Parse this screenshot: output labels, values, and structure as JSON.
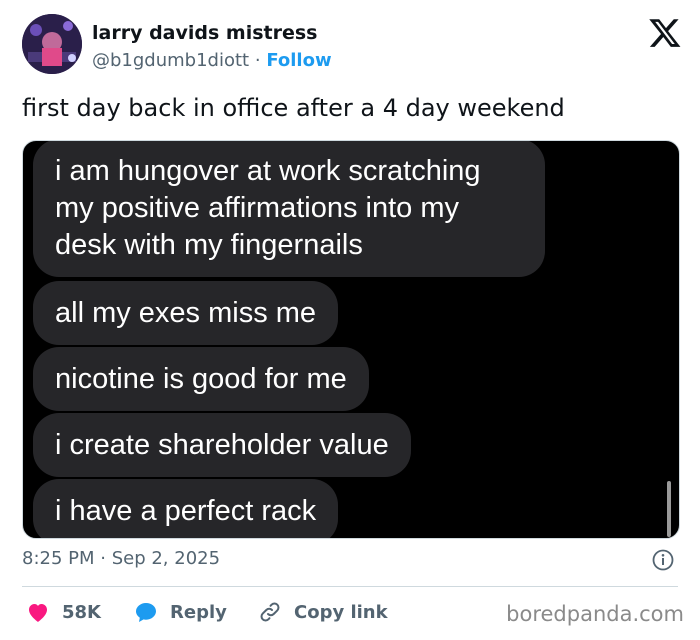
{
  "author": {
    "display_name": "larry davids mistress",
    "handle": "@b1gdumb1diott",
    "separator": "·",
    "follow_label": "Follow"
  },
  "tweet": {
    "text": "first day back in office after a 4 day weekend",
    "timestamp": "8:25 PM · Sep 2, 2025"
  },
  "media": {
    "bubbles": [
      "i am hungover at work scratching my positive affirmations into my desk with my fingernails",
      "all my exes miss me",
      "nicotine is good for me",
      "i create shareholder value",
      "i have a perfect rack"
    ]
  },
  "actions": {
    "likes": "58K",
    "reply_label": "Reply",
    "copy_label": "Copy link"
  },
  "watermark": "boredpanda.com",
  "colors": {
    "like": "#f91880",
    "reply": "#1d9bf0",
    "follow": "#1d9bf0",
    "bubble": "#262629",
    "muted": "#536471"
  },
  "icons": [
    "x-logo-icon",
    "info-icon",
    "heart-icon",
    "reply-bubble-icon",
    "link-icon"
  ]
}
